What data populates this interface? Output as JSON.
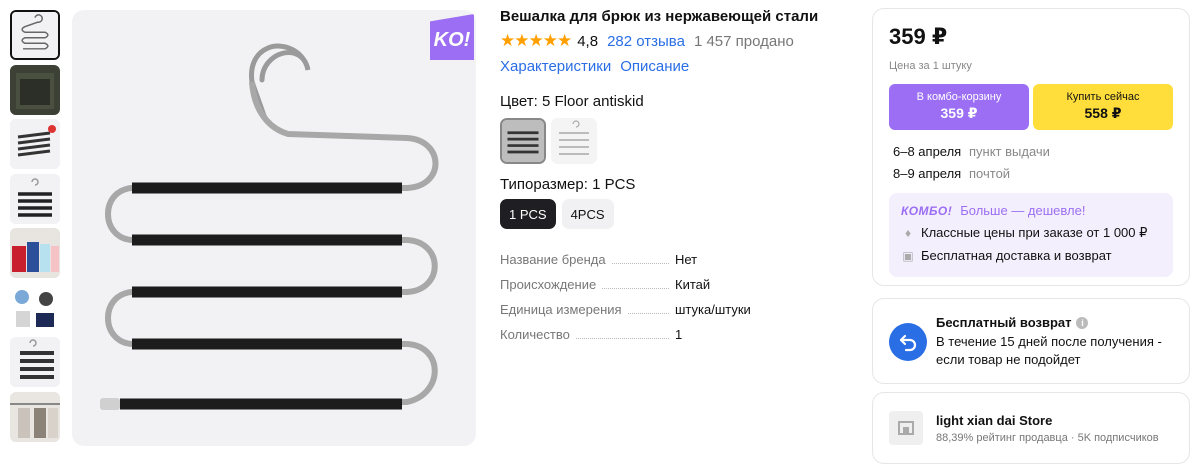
{
  "product": {
    "title": "Вешалка для брюк из нержавеющей стали",
    "stars": "★★★★★",
    "rating": "4,8",
    "reviews": "282 отзыва",
    "sold": "1 457 продано",
    "links": [
      "Характеристики",
      "Описание"
    ],
    "badge": "KO!"
  },
  "options": {
    "color_label": "Цвет: 5 Floor antiskid",
    "size_label": "Типоразмер: 1 PCS",
    "sizes": [
      "1 PCS",
      "4PCS"
    ]
  },
  "specs": [
    {
      "key": "Название бренда",
      "value": "Нет"
    },
    {
      "key": "Происхождение",
      "value": "Китай"
    },
    {
      "key": "Единица измерения",
      "value": "штука/штуки"
    },
    {
      "key": "Количество",
      "value": "1"
    }
  ],
  "buy": {
    "price": "359 ₽",
    "price_sub": "Цена за 1 штуку",
    "combo_btn_label": "В комбо-корзину",
    "combo_btn_price": "359 ₽",
    "buy_btn_label": "Купить сейчас",
    "buy_btn_price": "558 ₽",
    "delivery": [
      {
        "date": "6–8 апреля",
        "type": "пункт выдачи"
      },
      {
        "date": "8–9 апреля",
        "type": "почтой"
      }
    ],
    "combo": {
      "logo": "КОМБО!",
      "head": "Больше — дешевле!",
      "items": [
        "Классные цены при заказе от 1 000 ₽",
        "Бесплатная доставка и возврат"
      ]
    }
  },
  "returns": {
    "title": "Бесплатный возврат",
    "info": "i",
    "desc": "В течение 15 дней после получения - если товар не подойдет"
  },
  "store": {
    "name": "light xian dai Store",
    "meta": "88,39% рейтинг продавца · 5K подписчиков"
  },
  "colors": {
    "accent_blue": "#2a6ee6",
    "combo_purple": "#9b6ef3",
    "buy_yellow": "#ffde3b",
    "star": "#ff9f00"
  }
}
